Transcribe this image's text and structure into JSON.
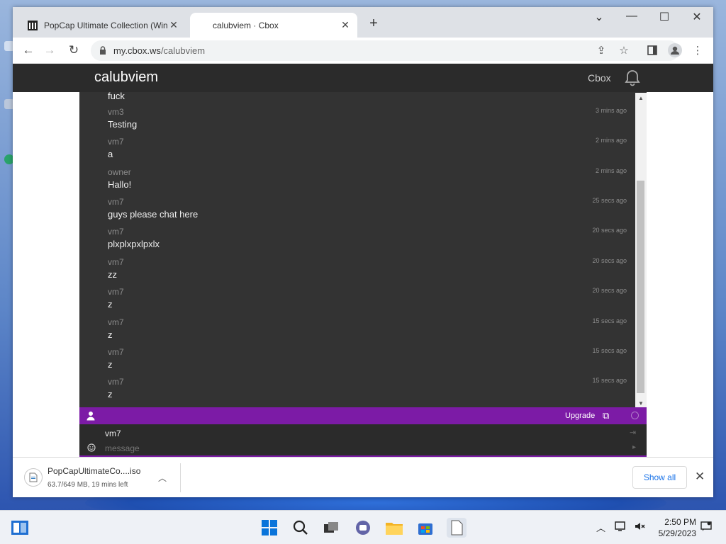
{
  "browser": {
    "tabs": [
      {
        "title": "PopCap Ultimate Collection (Win"
      },
      {
        "title": "calubviem · Cbox"
      }
    ],
    "url_host": "my.cbox.ws",
    "url_path": "/calubviem"
  },
  "cbox": {
    "title": "calubviem",
    "brand": "Cbox",
    "partial_message": "fuck",
    "messages": [
      {
        "user": "vm3",
        "text": "Testing",
        "time": "3 mins ago"
      },
      {
        "user": "vm7",
        "text": "a",
        "time": "2 mins ago"
      },
      {
        "user": "owner",
        "text": "Hallo!",
        "time": "2 mins ago"
      },
      {
        "user": "vm7",
        "text": "guys please chat here",
        "time": "25 secs ago"
      },
      {
        "user": "vm7",
        "text": "plxplxpxlpxlx",
        "time": "20 secs ago"
      },
      {
        "user": "vm7",
        "text": "zz",
        "time": "20 secs ago"
      },
      {
        "user": "vm7",
        "text": "z",
        "time": "20 secs ago"
      },
      {
        "user": "vm7",
        "text": "z",
        "time": "15 secs ago"
      },
      {
        "user": "vm7",
        "text": "z",
        "time": "15 secs ago"
      },
      {
        "user": "vm7",
        "text": "z",
        "time": "15 secs ago"
      }
    ],
    "upgrade_label": "Upgrade",
    "input": {
      "name": "vm7",
      "placeholder": "message"
    },
    "accent_color": "#7c1ba6"
  },
  "download": {
    "filename": "PopCapUltimateCo....iso",
    "status": "63.7/649 MB, 19 mins left",
    "show_all_label": "Show all"
  },
  "taskbar": {
    "time": "2:50 PM",
    "date": "5/29/2023"
  }
}
